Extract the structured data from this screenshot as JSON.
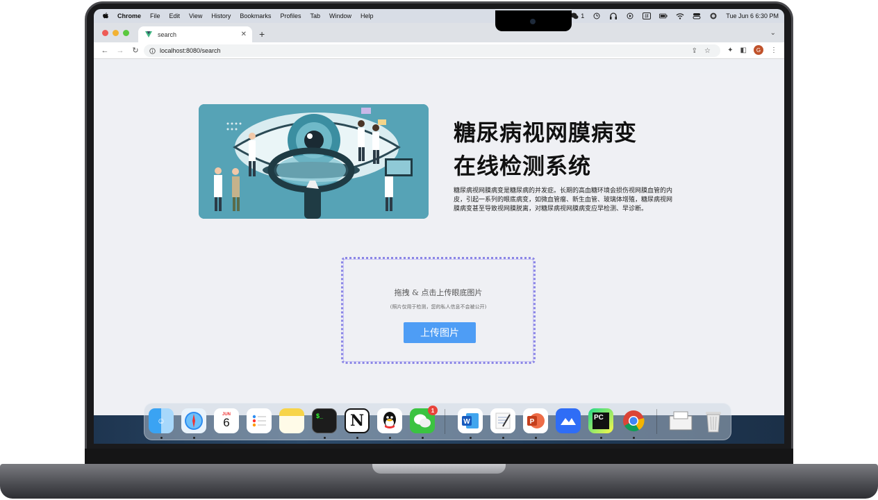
{
  "menubar": {
    "app": "Chrome",
    "items": [
      "File",
      "Edit",
      "View",
      "History",
      "Bookmarks",
      "Profiles",
      "Tab",
      "Window",
      "Help"
    ],
    "wechat_count": "1",
    "datetime": "Tue Jun 6  6:30 PM"
  },
  "browser": {
    "tab_title": "search",
    "url": "localhost:8080/search",
    "profile_initial": "G"
  },
  "page": {
    "title_line1": "糖尿病视网膜病变",
    "title_line2": "在线检测系统",
    "description": "糖尿病视网膜病变是糖尿病的并发症。长期的高血糖环境会损伤视网膜血管的内皮，引起一系列的眼底病变，如微血管瘤、新生血管、玻璃体增殖，糖尿病视网膜病变甚至导致视网膜脱离，对糖尿病视网膜病变应早检测、早诊断。",
    "upload_title": "拖拽 & 点击上传眼底图片",
    "upload_hint": "(照片仅用于检测，您的私人信息不会被公开)",
    "upload_button": "上传图片"
  },
  "dock": {
    "calendar_month": "JUN",
    "calendar_day": "6",
    "wechat_badge": "1",
    "apps": [
      "Finder",
      "Safari",
      "Calendar",
      "Reminders",
      "Notes",
      "Terminal",
      "Notion",
      "QQ",
      "WeChat",
      "Word",
      "TextEdit",
      "PowerPoint",
      "Lark",
      "PyCharm",
      "Chrome",
      "Preview",
      "Trash"
    ]
  },
  "colors": {
    "accent_button": "#4e9df5",
    "upload_border": "#8b86e6",
    "hero_bg": "#56a3b6"
  }
}
